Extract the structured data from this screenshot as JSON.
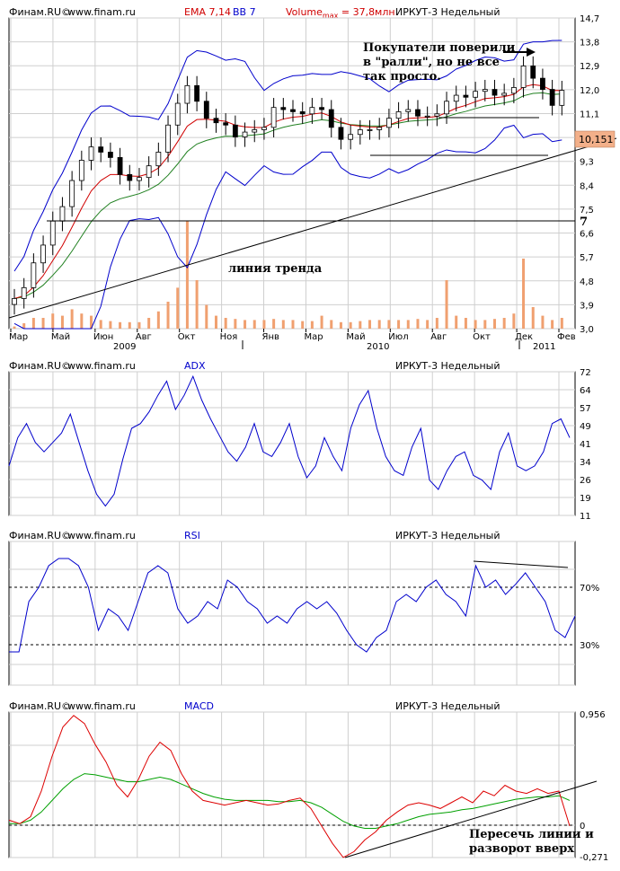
{
  "panels": {
    "price": {
      "header": {
        "brand": "Финам.RU©",
        "site": "www.finam.ru",
        "ema": "EMA 7,14",
        "bb": "BB 7",
        "vol_prefix": "Volume",
        "vol_sub": "max",
        "vol_suffix": " = 37,8млн.",
        "ticker": "ИРКУТ-3 Недельный"
      },
      "yticks": [
        "14,7",
        "13,8",
        "12,9",
        "12,0",
        "11,1",
        "10,2",
        "9,3",
        "8,4",
        "7,5",
        "6,6",
        "5,7",
        "4,8",
        "3,9",
        "3,0"
      ],
      "months": [
        "Мар",
        "Май",
        "Июн",
        "Авг",
        "Окт",
        "Ноя",
        "Янв",
        "Мар",
        "Май",
        "Июл",
        "Авг",
        "Окт",
        "Дек",
        "Фев"
      ],
      "years": [
        "2009",
        "2010",
        "2011"
      ],
      "price_tag": "10,151",
      "level_label": "7",
      "annotation_buyers": [
        "Покупатели поверили",
        "в \"ралли\", но не все",
        "так просто."
      ],
      "annotation_trend": "линия тренда"
    },
    "adx": {
      "header": {
        "brand": "Финам.RU©",
        "site": "www.finam.ru",
        "indicator": "ADX",
        "ticker": "ИРКУТ-3 Недельный"
      },
      "yticks": [
        "72",
        "64",
        "57",
        "49",
        "41",
        "34",
        "26",
        "19",
        "11"
      ]
    },
    "rsi": {
      "header": {
        "brand": "Финам.RU©",
        "site": "www.finam.ru",
        "indicator": "RSI",
        "ticker": "ИРКУТ-3 Недельный"
      },
      "level_labels": [
        "70%",
        "30%"
      ]
    },
    "macd": {
      "header": {
        "brand": "Финам.RU©",
        "site": "www.finam.ru",
        "indicator": "MACD",
        "ticker": "ИРКУТ-3 Недельный"
      },
      "yticks": [
        "0,956",
        "0",
        "-0,271"
      ],
      "annotation": [
        "Пересечь линии и",
        "разворот вверх"
      ]
    }
  },
  "colors": {
    "frame": "#000000",
    "grid": "#cfcfcf",
    "bg": "#ffffff",
    "ema_fast": "#d00000",
    "ema_slow": "#208020",
    "bollinger": "#0000cc",
    "volume": "#f0a070",
    "adx": "#0000cc",
    "rsi": "#0000cc",
    "macd": "#dd0000",
    "signal": "#00a000",
    "price_tag": "#f3b08a"
  },
  "chart_data": [
    {
      "type": "candlestick",
      "title": "ИРКУТ-3 Недельный",
      "ylim": [
        3.0,
        14.7
      ],
      "y_scale": "log",
      "x_labels": [
        "Мар",
        "Май",
        "Июн",
        "Авг",
        "Окт",
        "Ноя",
        "Янв",
        "Мар",
        "Май",
        "Июл",
        "Авг",
        "Окт",
        "Дек",
        "Фев"
      ],
      "close": [
        3.5,
        3.7,
        4.2,
        4.6,
        5.2,
        5.6,
        6.4,
        7.1,
        7.6,
        7.4,
        7.2,
        6.6,
        6.4,
        6.5,
        6.9,
        7.4,
        8.5,
        9.5,
        10.4,
        9.6,
        8.8,
        8.6,
        8.5,
        8.0,
        8.2,
        8.3,
        8.4,
        9.3,
        9.2,
        9.1,
        9.0,
        9.3,
        9.2,
        8.4,
        7.9,
        8.1,
        8.3,
        8.3,
        8.4,
        8.8,
        9.1,
        9.2,
        8.9,
        8.9,
        9.0,
        9.6,
        9.9,
        9.8,
        10.1,
        10.2,
        9.9,
        10.0,
        10.3,
        11.5,
        10.8,
        10.2,
        9.4,
        10.151
      ],
      "line_series": [
        {
          "name": "EMA 7",
          "color": "#d00000"
        },
        {
          "name": "EMA 14",
          "color": "#208020"
        },
        {
          "name": "BB 7",
          "color": "#0000cc"
        }
      ],
      "volume": {
        "max": 37.8,
        "unit": "млн.",
        "values": [
          0.02,
          0.05,
          0.1,
          0.1,
          0.14,
          0.12,
          0.18,
          0.14,
          0.12,
          0.08,
          0.07,
          0.06,
          0.06,
          0.06,
          0.1,
          0.16,
          0.25,
          0.38,
          1.0,
          0.45,
          0.22,
          0.12,
          0.1,
          0.09,
          0.08,
          0.08,
          0.08,
          0.09,
          0.08,
          0.08,
          0.07,
          0.07,
          0.12,
          0.08,
          0.06,
          0.06,
          0.07,
          0.08,
          0.08,
          0.08,
          0.08,
          0.08,
          0.09,
          0.08,
          0.1,
          0.45,
          0.12,
          0.1,
          0.08,
          0.08,
          0.09,
          0.1,
          0.14,
          0.65,
          0.2,
          0.12,
          0.08,
          0.1
        ]
      },
      "support_level": 7,
      "annotations": [
        "Покупатели поверили в \"ралли\", но не все так просто.",
        "линия тренда"
      ]
    },
    {
      "type": "line",
      "title": "ADX",
      "ylim": [
        11,
        72
      ],
      "series": [
        {
          "name": "ADX",
          "values": [
            32,
            44,
            50,
            42,
            38,
            42,
            46,
            54,
            42,
            30,
            20,
            15,
            20,
            35,
            48,
            50,
            55,
            62,
            68,
            56,
            62,
            70,
            60,
            52,
            45,
            38,
            34,
            40,
            50,
            38,
            36,
            42,
            50,
            36,
            27,
            32,
            44,
            36,
            30,
            48,
            58,
            64,
            48,
            36,
            30,
            28,
            40,
            48,
            26,
            22,
            30,
            36,
            38,
            28,
            26,
            22,
            38,
            46,
            32,
            30,
            32,
            38,
            50,
            52,
            44
          ]
        }
      ]
    },
    {
      "type": "line",
      "title": "RSI",
      "levels": [
        70,
        30
      ],
      "series": [
        {
          "name": "RSI",
          "values": [
            25,
            25,
            60,
            70,
            85,
            90,
            90,
            85,
            70,
            40,
            55,
            50,
            40,
            60,
            80,
            85,
            80,
            55,
            45,
            50,
            60,
            55,
            75,
            70,
            60,
            55,
            45,
            50,
            45,
            55,
            60,
            55,
            60,
            52,
            40,
            30,
            25,
            35,
            40,
            60,
            65,
            60,
            70,
            75,
            65,
            60,
            50,
            85,
            70,
            75,
            65,
            72,
            80,
            70,
            60,
            40,
            35,
            50
          ]
        }
      ]
    },
    {
      "type": "line",
      "title": "MACD",
      "ylim": [
        -0.271,
        0.956
      ],
      "series": [
        {
          "name": "MACD",
          "values": [
            0.05,
            0.02,
            0.08,
            0.3,
            0.6,
            0.85,
            0.95,
            0.88,
            0.7,
            0.55,
            0.35,
            0.25,
            0.4,
            0.6,
            0.72,
            0.65,
            0.45,
            0.3,
            0.22,
            0.2,
            0.18,
            0.2,
            0.22,
            0.2,
            0.18,
            0.19,
            0.22,
            0.24,
            0.15,
            0.0,
            -0.15,
            -0.27,
            -0.22,
            -0.12,
            -0.05,
            0.05,
            0.12,
            0.18,
            0.2,
            0.18,
            0.15,
            0.2,
            0.25,
            0.2,
            0.3,
            0.26,
            0.35,
            0.3,
            0.28,
            0.32,
            0.28,
            0.3,
            0.0
          ]
        },
        {
          "name": "Signal",
          "values": [
            0.02,
            0.02,
            0.05,
            0.12,
            0.22,
            0.32,
            0.4,
            0.45,
            0.44,
            0.42,
            0.4,
            0.38,
            0.38,
            0.4,
            0.42,
            0.4,
            0.36,
            0.32,
            0.28,
            0.25,
            0.23,
            0.22,
            0.22,
            0.22,
            0.22,
            0.21,
            0.21,
            0.22,
            0.2,
            0.16,
            0.1,
            0.04,
            0.0,
            -0.02,
            -0.02,
            0.0,
            0.02,
            0.05,
            0.08,
            0.1,
            0.11,
            0.12,
            0.14,
            0.15,
            0.17,
            0.19,
            0.21,
            0.23,
            0.24,
            0.25,
            0.25,
            0.26,
            0.22
          ]
        }
      ]
    }
  ]
}
